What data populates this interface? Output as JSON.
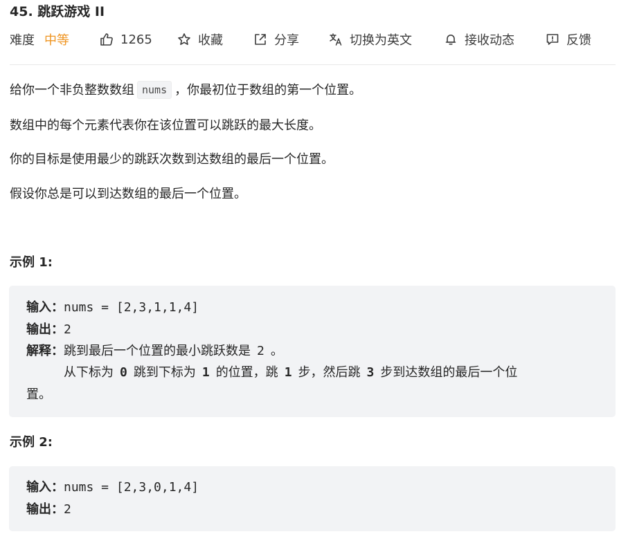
{
  "problem": {
    "title": "45. 跳跃游戏 II"
  },
  "meta": {
    "difficulty_label": "难度",
    "difficulty_value": "中等",
    "likes": "1265",
    "favorite_label": "收藏",
    "share_label": "分享",
    "translate_label": "切换为英文",
    "subscribe_label": "接收动态",
    "feedback_label": "反馈"
  },
  "description": {
    "p1_before": "给你一个非负整数数组",
    "p1_code": "nums",
    "p1_after": "，你最初位于数组的第一个位置。",
    "p2": "数组中的每个元素代表你在该位置可以跳跃的最大长度。",
    "p3": "你的目标是使用最少的跳跃次数到达数组的最后一个位置。",
    "p4": "假设你总是可以到达数组的最后一个位置。"
  },
  "examples": [
    {
      "title": "示例 1:",
      "input_label": "输入：",
      "input_value": "nums = [2,3,1,1,4]",
      "output_label": "输出：",
      "output_value": "2",
      "explain_label": "解释：",
      "explain_line1_text": "跳到最后一个位置的最小跳跃数是",
      "explain_line1_num": "2",
      "explain_line1_end": "。",
      "explain_line2_a": "从下标为",
      "explain_line2_n1": "0",
      "explain_line2_b": "跳到下标为",
      "explain_line2_n2": "1",
      "explain_line2_c": "的位置，跳",
      "explain_line2_n3": "1",
      "explain_line2_d": "步，然后跳",
      "explain_line2_n4": "3",
      "explain_line2_e": "步到达数组的最后一个位",
      "explain_line3": "置。"
    },
    {
      "title": "示例 2:",
      "input_label": "输入：",
      "input_value": "nums = [2,3,0,1,4]",
      "output_label": "输出：",
      "output_value": "2"
    }
  ],
  "colors": {
    "difficulty_medium": "#ef9420",
    "text_primary": "#262626",
    "text_secondary": "#3c3c3c",
    "example_bg": "#f2f3f5"
  },
  "icons": {
    "likes": "thumbs-up-icon",
    "favorite": "star-icon",
    "share": "share-icon",
    "translate": "translate-icon",
    "subscribe": "bell-icon",
    "feedback": "feedback-icon"
  }
}
